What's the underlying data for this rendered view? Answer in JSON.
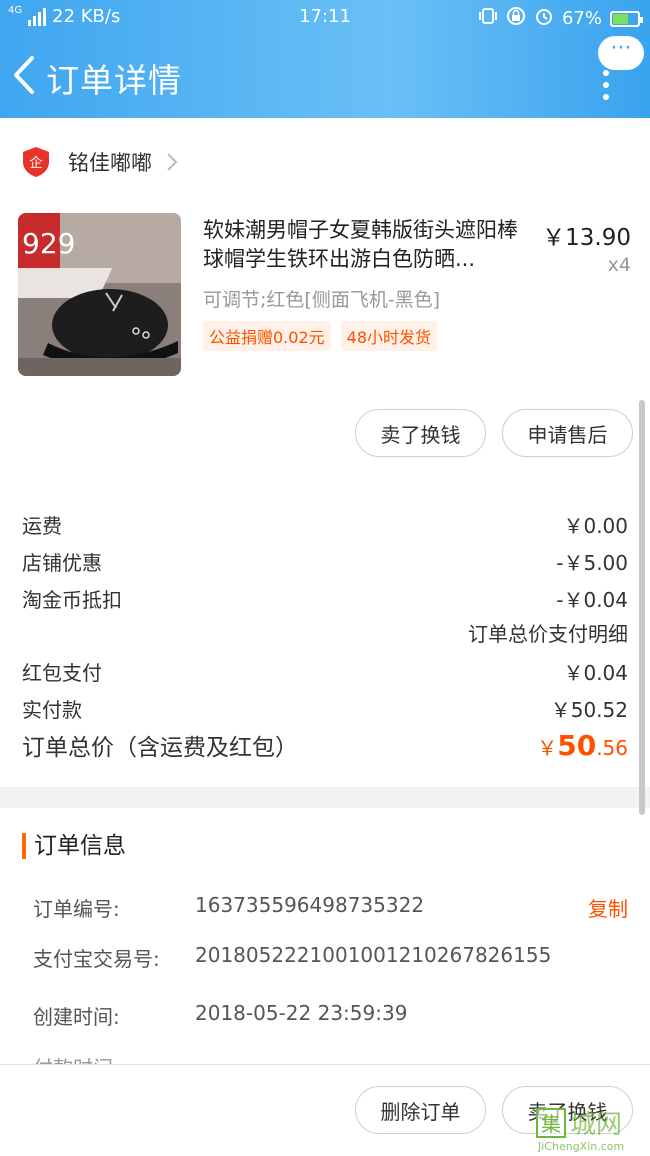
{
  "status_bar": {
    "network": "4G",
    "speed": "22 KB/s",
    "time": "17:11",
    "battery": "67%",
    "battery_level": 0.67
  },
  "header": {
    "title": "订单详情",
    "more_label": "···"
  },
  "shop": {
    "name": "铭佳嘟嘟",
    "badge": "企"
  },
  "item": {
    "title": "软妹潮男帽子女夏韩版街头遮阳棒球帽学生铁环出游白色防晒...",
    "price": "￥13.90",
    "qty": "x4",
    "sku": "可调节;红色[侧面飞机-黑色]",
    "tags": [
      "公益捐赠0.02元",
      "48小时发货"
    ],
    "thumb_text": "929"
  },
  "item_actions": {
    "sell": "卖了换钱",
    "after_sale": "申请售后"
  },
  "fees": [
    {
      "label": "运费",
      "value": "￥0.00"
    },
    {
      "label": "店铺优惠",
      "value": "-￥5.00"
    },
    {
      "label": "淘金币抵扣",
      "value": "-￥0.04"
    }
  ],
  "pay_detail_label": "订单总价支付明细",
  "payments": [
    {
      "label": "红包支付",
      "value": "￥0.04"
    },
    {
      "label": "实付款",
      "value": "￥50.52"
    }
  ],
  "total": {
    "label": "订单总价（含运费及红包）",
    "currency": "￥",
    "int": "50",
    "dec": ".56"
  },
  "order_info": {
    "title": "订单信息",
    "copy_label": "复制",
    "rows": [
      {
        "label": "订单编号:",
        "value": "163735596498735322"
      },
      {
        "label": "支付宝交易号:",
        "value": "2018052221001001210267826155"
      },
      {
        "label": "创建时间:",
        "value": "2018-05-22 23:59:39"
      }
    ],
    "cut_label": "付款时间:"
  },
  "bottom_actions": {
    "delete": "删除订单",
    "sell": "卖了换钱"
  },
  "watermark": {
    "char": "集",
    "text": "城网",
    "url": "JiChengXin.com"
  }
}
